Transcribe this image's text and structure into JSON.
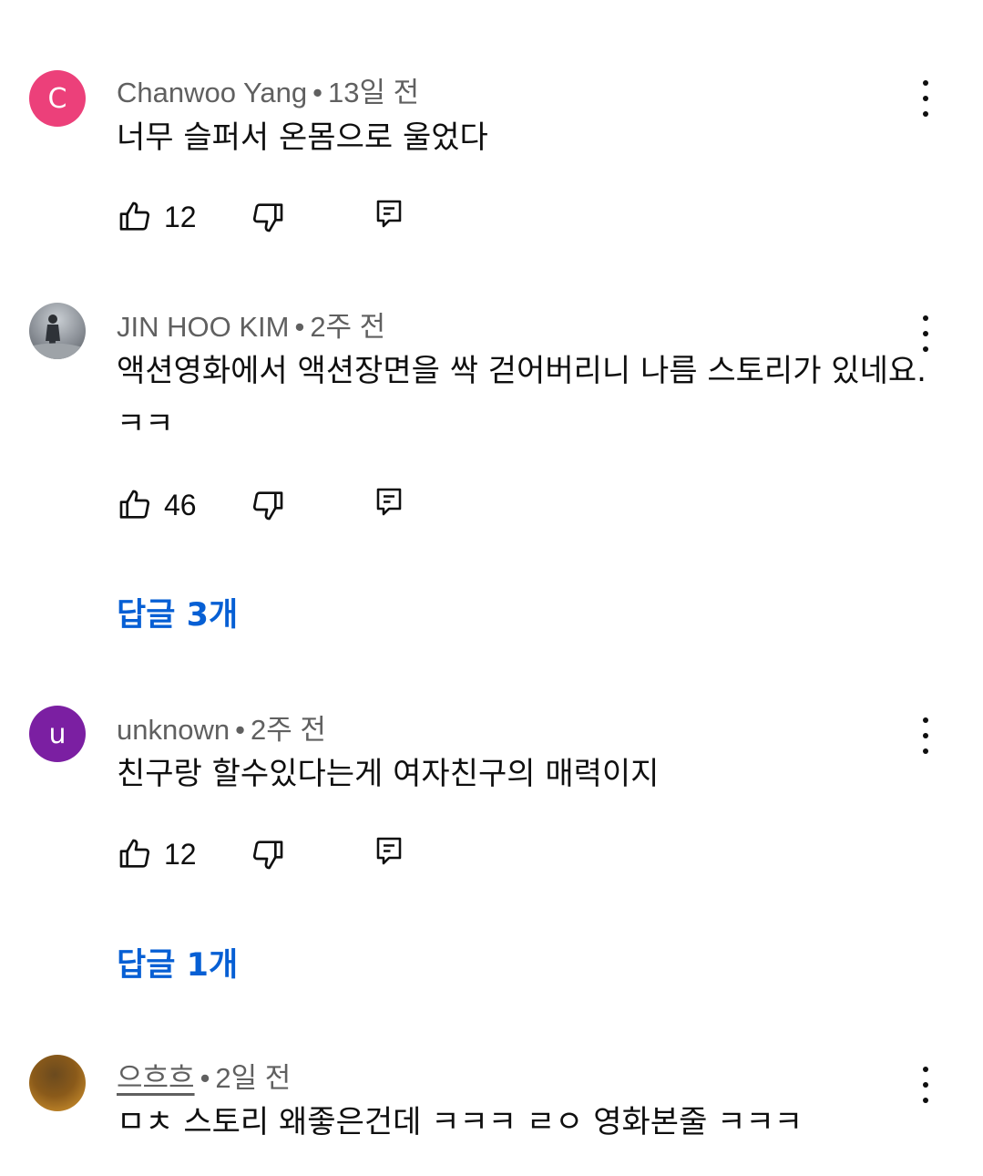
{
  "comments": [
    {
      "avatar_letter": "C",
      "avatar_color": "#ec407a",
      "author": "Chanwoo Yang",
      "time": "13일 전",
      "text": "너무 슬퍼서 온몸으로 울었다",
      "likes": "12"
    },
    {
      "avatar_letter": "",
      "avatar_color": "#8a8f96",
      "author": "JIN HOO KIM",
      "time": "2주 전",
      "text": "액션영화에서 액션장면을 싹 걷어버리니 나름 스토리가 있네요. ㅋㅋ",
      "likes": "46",
      "replies": "답글 3개"
    },
    {
      "avatar_letter": "u",
      "avatar_color": "#7b1fa2",
      "author": "unknown",
      "time": "2주 전",
      "text": "친구랑 할수있다는게 여자친구의 매력이지",
      "likes": "12",
      "replies": "답글 1개"
    },
    {
      "avatar_letter": "",
      "avatar_color": "#a8701c",
      "author": "으흐흐",
      "time": "2일 전",
      "text": "ㅁㅊ 스토리 왜좋은건데 ㅋㅋㅋ ㄹㅇ 영화본줄 ㅋㅋㅋ"
    }
  ],
  "separator": "•",
  "colors": {
    "link": "#065fd4",
    "meta": "#606060",
    "text": "#0f0f0f"
  }
}
